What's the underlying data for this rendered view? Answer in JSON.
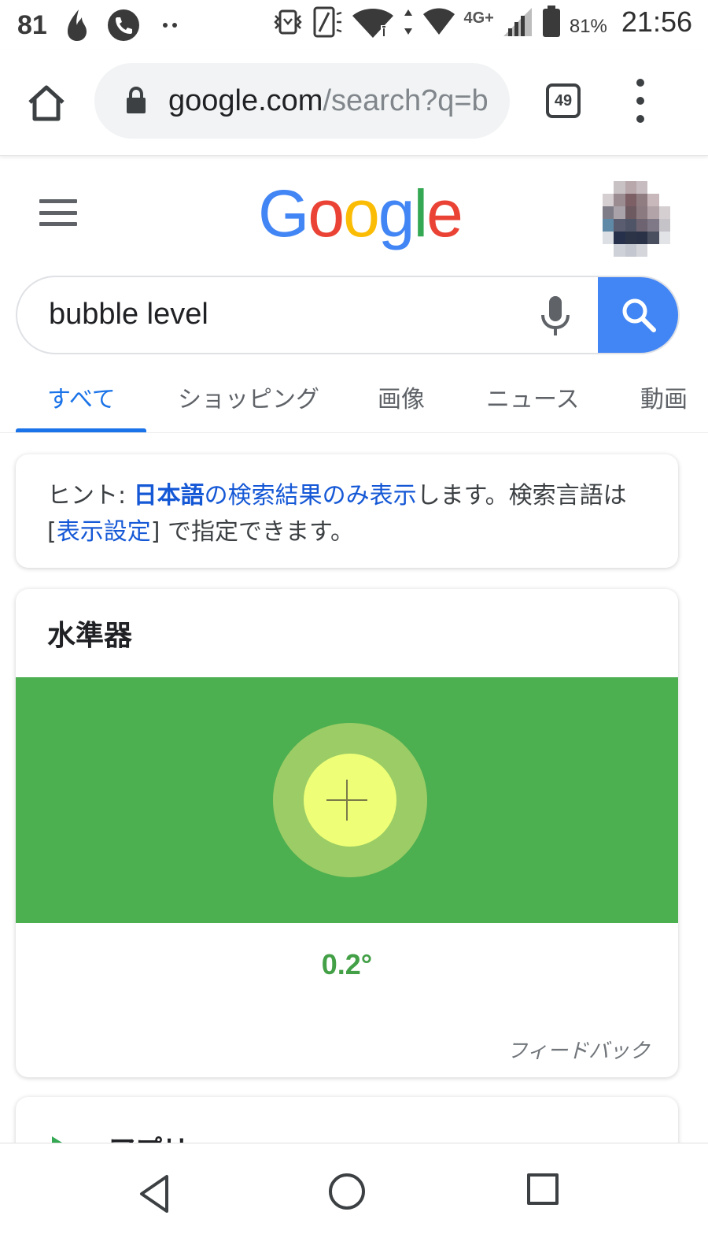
{
  "status_bar": {
    "notification_count": "81",
    "battery_percent": "81%",
    "time": "21:56",
    "network": "4G+",
    "icons": [
      "flame-icon",
      "phone-icon",
      "more-dots-icon",
      "vibrate-icon",
      "nfc-icon",
      "wifi-icon",
      "signal-icon",
      "battery-icon"
    ]
  },
  "browser": {
    "url_host": "google.com",
    "url_path": "/search?q=b",
    "tab_count": "49",
    "icons": [
      "home-icon",
      "lock-icon",
      "tab-switcher-icon",
      "menu-icon"
    ]
  },
  "google": {
    "logo_letters": [
      "G",
      "o",
      "o",
      "g",
      "l",
      "e"
    ],
    "logo_colors": [
      "#4285F4",
      "#EA4335",
      "#FBBC05",
      "#4285F4",
      "#34A853",
      "#EA4335"
    ]
  },
  "search": {
    "query": "bubble level"
  },
  "tabs": [
    {
      "label": "すべて",
      "active": true
    },
    {
      "label": "ショッピング",
      "active": false
    },
    {
      "label": "画像",
      "active": false
    },
    {
      "label": "ニュース",
      "active": false
    },
    {
      "label": "動画",
      "active": false
    }
  ],
  "hint": {
    "prefix": "ヒント: ",
    "link_bold": "日本語",
    "link_rest": "の検索結果のみ表示",
    "middle": "します。検索言語は [",
    "settings_link": "表示設定",
    "suffix": "] で指定できます。"
  },
  "level_widget": {
    "title": "水準器",
    "angle": "0.2°",
    "feedback": "フィードバック",
    "colors": {
      "field": "#4caf50",
      "bubble_outer": "#9ccc65",
      "bubble_inner": "#eeff77",
      "angle_text": "#43a047"
    }
  },
  "apps_section": {
    "title": "アプリ"
  },
  "nav_bar": {
    "icons": [
      "back-icon",
      "home-circle-icon",
      "recents-icon"
    ]
  },
  "colors": {
    "link_blue": "#1558d6",
    "tab_active": "#1a73e8",
    "search_button": "#4285f4"
  }
}
